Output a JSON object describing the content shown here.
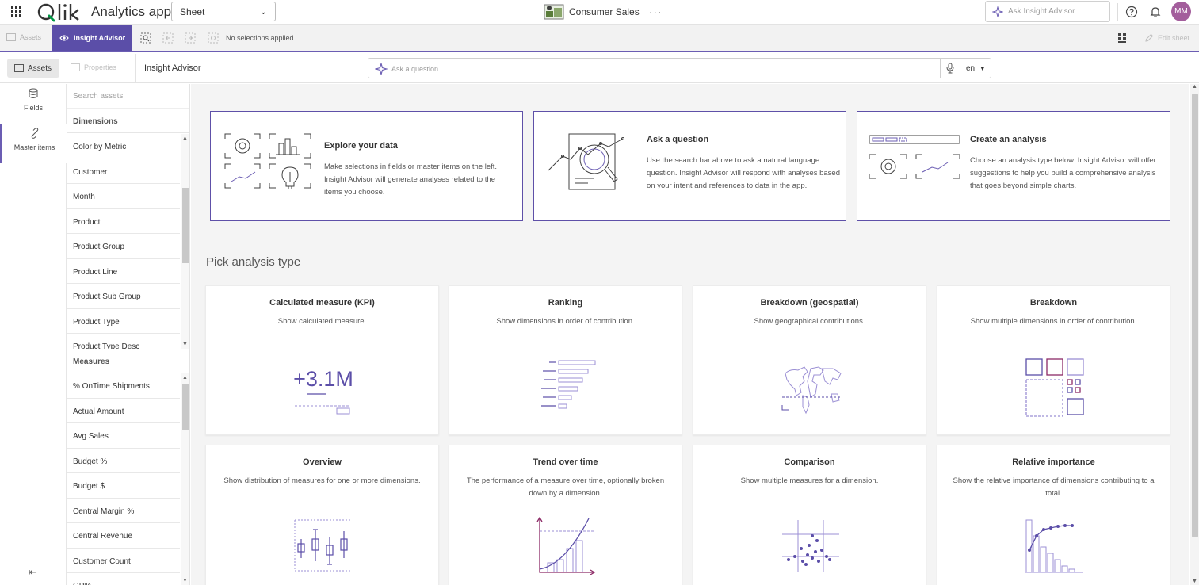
{
  "header": {
    "app_title": "Analytics app",
    "sheet_select": "Sheet",
    "center_app_name": "Consumer Sales",
    "more": "···",
    "ask_placeholder": "Ask Insight Advisor",
    "avatar_initials": "MM"
  },
  "toolbar": {
    "assets": "Assets",
    "insight_advisor": "Insight Advisor",
    "no_selections": "No selections applied",
    "edit_sheet": "Edit sheet"
  },
  "subbar": {
    "assets": "Assets",
    "properties": "Properties",
    "title": "Insight Advisor",
    "question_placeholder": "Ask a question",
    "language": "en"
  },
  "rail": {
    "fields": "Fields",
    "master_items": "Master items"
  },
  "assets": {
    "search_placeholder": "Search assets",
    "dimensions_label": "Dimensions",
    "dimensions": [
      "Color by Metric",
      "Customer",
      "Month",
      "Product",
      "Product Group",
      "Product Line",
      "Product Sub Group",
      "Product Type",
      "Product Type Desc"
    ],
    "measures_label": "Measures",
    "measures": [
      "% OnTime Shipments",
      "Actual Amount",
      "Avg Sales",
      "Budget %",
      "Budget $",
      "Central Margin %",
      "Central Revenue",
      "Customer Count",
      "GP%"
    ]
  },
  "info_cards": [
    {
      "title": "Explore your data",
      "desc": "Make selections in fields or master items on the left. Insight Advisor will generate analyses related to the items you choose."
    },
    {
      "title": "Ask a question",
      "desc": "Use the search bar above to ask a natural language question. Insight Advisor will respond with analyses based on your intent and references to data in the app."
    },
    {
      "title": "Create an analysis",
      "desc": "Choose an analysis type below. Insight Advisor will offer suggestions to help you build a comprehensive analysis that goes beyond simple charts."
    }
  ],
  "pick_title": "Pick analysis type",
  "kpi_sample": "+3.1M",
  "types": [
    {
      "title": "Calculated measure (KPI)",
      "desc": "Show calculated measure."
    },
    {
      "title": "Ranking",
      "desc": "Show dimensions in order of contribution."
    },
    {
      "title": "Breakdown (geospatial)",
      "desc": "Show geographical contributions."
    },
    {
      "title": "Breakdown",
      "desc": "Show multiple dimensions in order of contribution."
    },
    {
      "title": "Overview",
      "desc": "Show distribution of measures for one or more dimensions."
    },
    {
      "title": "Trend over time",
      "desc": "The performance of a measure over time, optionally broken down by a dimension."
    },
    {
      "title": "Comparison",
      "desc": "Show multiple measures for a dimension."
    },
    {
      "title": "Relative importance",
      "desc": "Show the relative importance of dimensions contributing to a total."
    }
  ],
  "colors": {
    "accent": "#5b4ea8",
    "avatar": "#a35e9c"
  }
}
